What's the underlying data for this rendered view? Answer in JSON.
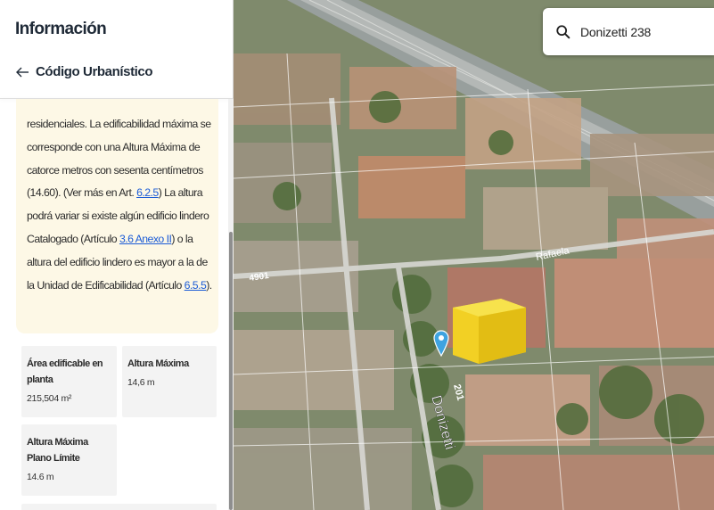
{
  "panel": {
    "title": "Información",
    "back_label": "Código Urbanístico",
    "info_text_part1": "residenciales. La edificabilidad máxima se corresponde con una Altura Máxima de catorce metros con sesenta centímetros (14.60). (Ver más en Art. ",
    "info_link1": "6.2.5",
    "info_text_part2": ") La altura podrá variar si existe algún edificio lindero Catalogado (Artículo ",
    "info_link2": "3.6 Anexo II",
    "info_text_part3": ") o la altura del edificio lindero es mayor a la de la Unidad de Edificabilidad (Artículo ",
    "info_link3": "6.5.5",
    "info_text_part4": ").",
    "stats": [
      {
        "label": "Área edificable en planta",
        "value": "215,504 m²"
      },
      {
        "label": "Altura Máxima",
        "value": "14,6 m"
      },
      {
        "label": "Altura Máxima Plano Límite",
        "value": "14.6 m"
      },
      {
        "label": "",
        "value": ""
      }
    ]
  },
  "search": {
    "value": "Donizetti 238"
  },
  "map": {
    "street_labels": [
      "Donizetti",
      "201",
      "Rafaela",
      "4901"
    ],
    "highlight_color": "#f2d024",
    "pin_color": "#3fa3e0"
  }
}
